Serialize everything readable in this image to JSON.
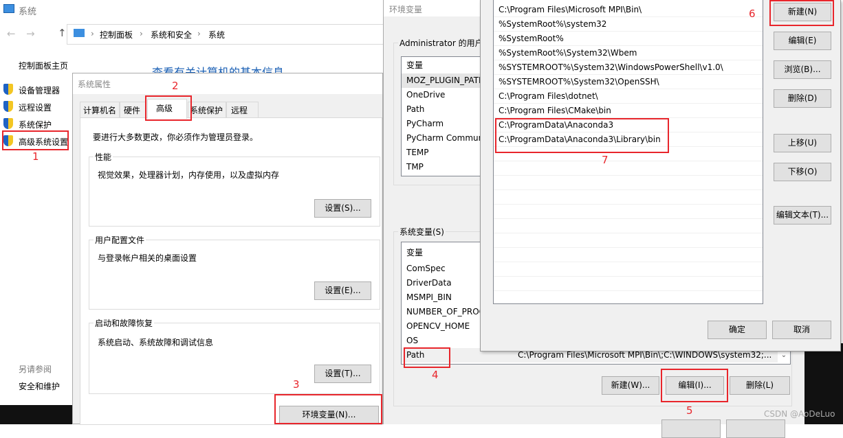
{
  "system_window": {
    "title": "系统",
    "breadcrumb": [
      "控制面板",
      "系统和安全",
      "系统"
    ],
    "home": "控制面板主页",
    "heading": "查看有关计算机的基本信息",
    "sidebar": [
      {
        "label": "设备管理器",
        "icon": "shield-icon"
      },
      {
        "label": "远程设置",
        "icon": "shield-icon"
      },
      {
        "label": "系统保护",
        "icon": "shield-icon"
      },
      {
        "label": "高级系统设置",
        "icon": "shield-icon"
      }
    ],
    "see_also": "另请参阅",
    "security": "安全和维护"
  },
  "sys_props": {
    "title": "系统属性",
    "tabs": [
      "计算机名",
      "硬件",
      "高级",
      "系统保护",
      "远程"
    ],
    "active_tab": "高级",
    "admin_note": "要进行大多数更改，你必须作为管理员登录。",
    "groups": [
      {
        "label": "性能",
        "desc": "视觉效果，处理器计划，内存使用，以及虚拟内存",
        "button": "设置(S)..."
      },
      {
        "label": "用户配置文件",
        "desc": "与登录帐户相关的桌面设置",
        "button": "设置(E)..."
      },
      {
        "label": "启动和故障恢复",
        "desc": "系统启动、系统故障和调试信息",
        "button": "设置(T)..."
      }
    ],
    "env_button": "环境变量(N)..."
  },
  "env_vars": {
    "title": "环境变量",
    "user_group": "Administrator 的用户变",
    "user_header": "变量",
    "user_vars": [
      "MOZ_PLUGIN_PATH",
      "OneDrive",
      "Path",
      "PyCharm",
      "PyCharm Communi",
      "TEMP",
      "TMP"
    ],
    "sys_group": "系统变量(S)",
    "sys_header": "变量",
    "sys_vars": [
      "ComSpec",
      "DriverData",
      "MSMPI_BIN",
      "NUMBER_OF_PROC",
      "OPENCV_HOME",
      "OS",
      "Path"
    ],
    "path_value": "C:\\Program Files\\Microsoft MPI\\Bin\\;C:\\WINDOWS\\system32;...",
    "new": "新建(W)...",
    "edit": "编辑(I)...",
    "delete": "删除(L)"
  },
  "edit_path": {
    "items": [
      "C:\\Program Files\\Microsoft MPI\\Bin\\",
      "%SystemRoot%\\system32",
      "%SystemRoot%",
      "%SystemRoot%\\System32\\Wbem",
      "%SYSTEMROOT%\\System32\\WindowsPowerShell\\v1.0\\",
      "%SYSTEMROOT%\\System32\\OpenSSH\\",
      "C:\\Program Files\\dotnet\\",
      "C:\\Program Files\\CMake\\bin",
      "C:\\ProgramData\\Anaconda3",
      "C:\\ProgramData\\Anaconda3\\Library\\bin"
    ],
    "buttons": [
      "新建(N)",
      "编辑(E)",
      "浏览(B)...",
      "删除(D)",
      "上移(U)",
      "下移(O)",
      "编辑文本(T)..."
    ],
    "ok": "确定",
    "cancel": "取消"
  },
  "annotations": [
    "1",
    "2",
    "3",
    "4",
    "5",
    "6",
    "7"
  ],
  "watermark": "CSDN @AoDeLuo",
  "colors": {
    "annotation": "#e8252b",
    "heading": "#1a5fb4",
    "dialog_bg": "#f0f0f0"
  }
}
